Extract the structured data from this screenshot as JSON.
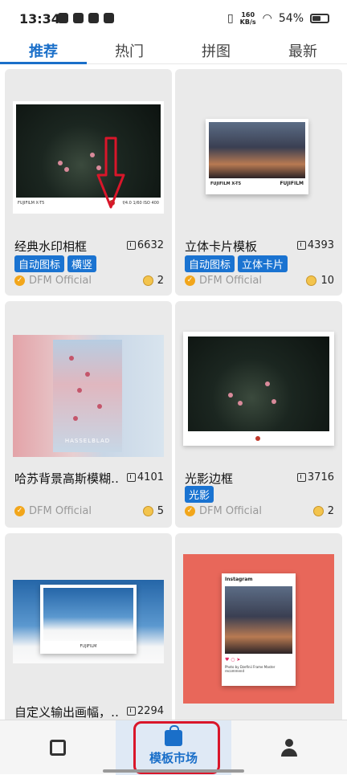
{
  "status": {
    "time": "13:34",
    "net_speed_top": "160",
    "net_speed_bottom": "KB/s",
    "battery": "54%"
  },
  "tabs": [
    {
      "label": "推荐"
    },
    {
      "label": "热门"
    },
    {
      "label": "拼图"
    },
    {
      "label": "最新"
    }
  ],
  "cards": [
    {
      "title": "经典水印相框",
      "downloads": "6632",
      "tags": [
        "自动图标",
        "横竖"
      ],
      "author": "DFM Official",
      "coins": "2",
      "thumb_brand": "FUJIFILM X-T5",
      "thumb_info": "f/4.0 1/60 ISO 400"
    },
    {
      "title": "立体卡片模板",
      "downloads": "4393",
      "tags": [
        "自动图标",
        "立体卡片"
      ],
      "author": "DFM Official",
      "coins": "10",
      "thumb_brand": "FUJIFILM",
      "thumb_brand2": "FUJIFILM X-T5"
    },
    {
      "title": "哈苏背景高斯模糊…",
      "downloads": "4101",
      "tags": [],
      "author": "DFM Official",
      "coins": "5",
      "thumb_brand": "HASSELBLAD"
    },
    {
      "title": "光影边框",
      "downloads": "3716",
      "tags": [
        "光影"
      ],
      "author": "DFM Official",
      "coins": "2"
    },
    {
      "title": "自定义输出画幅，…",
      "downloads": "2294",
      "tags": [],
      "author": "",
      "coins": "",
      "thumb_brand": "FUJIFILM"
    },
    {
      "title": "",
      "downloads": "",
      "tags": [],
      "author": "",
      "coins": "",
      "thumb_brand": "Instagram",
      "thumb_caption": "Photo by Dzefinii Frame Master recommend"
    }
  ],
  "nav": {
    "market_label": "模板市场"
  },
  "colors": {
    "accent": "#1a6fc9",
    "tag": "#1a73d1",
    "annotation": "#d9162a"
  }
}
